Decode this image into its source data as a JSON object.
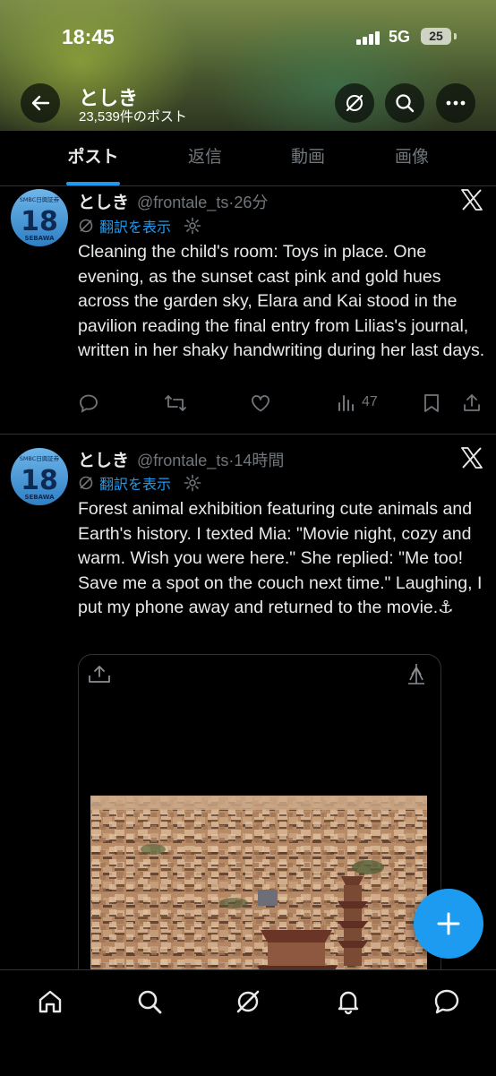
{
  "status_bar": {
    "time": "18:45",
    "network": "5G",
    "battery": "25"
  },
  "profile": {
    "name": "としき",
    "post_count": "23,539件のポスト"
  },
  "tabs": [
    {
      "label": "ポスト",
      "active": true
    },
    {
      "label": "返信",
      "active": false
    },
    {
      "label": "動画",
      "active": false
    },
    {
      "label": "画像",
      "active": false
    }
  ],
  "tweets": [
    {
      "name": "としき",
      "handle": "@frontale_ts",
      "time": "26分",
      "translate_label": "翻訳を表示",
      "avatar_number": "18",
      "avatar_top_text": "SMBC日興証券",
      "avatar_bottom_text": "SEBAWA",
      "text": "Cleaning the child's room: Toys in place. One evening, as the sunset cast pink and gold hues across the garden sky, Elara and Kai stood in the pavilion reading the final entry from Lilias's journal, written in her shaky handwriting during her last days.",
      "views": "47"
    },
    {
      "name": "としき",
      "handle": "@frontale_ts",
      "time": "14時間",
      "translate_label": "翻訳を表示",
      "avatar_number": "18",
      "avatar_top_text": "SMBC日興証券",
      "avatar_bottom_text": "SEBAWA",
      "text": "Forest animal exhibition featuring cute animals and Earth's history. I texted Mia: \"Movie night, cozy and warm. Wish you were here.\" She replied: \"Me too! Save me a spot on the couch next time.\" Laughing, I put my phone away and returned to the movie.⚓"
    }
  ],
  "colors": {
    "accent": "#1d9bf0",
    "background": "#000000",
    "text": "#e7e9ea",
    "muted": "#71767b",
    "divider": "#2f3336"
  },
  "icons": [
    "back-arrow-icon",
    "grok-icon",
    "search-icon",
    "more-icon",
    "reply-icon",
    "repost-icon",
    "like-icon",
    "views-icon",
    "bookmark-icon",
    "share-icon",
    "x-logo-icon",
    "translate-icon",
    "gear-icon",
    "home-icon",
    "bell-icon",
    "messages-icon",
    "compose-plus-icon"
  ]
}
